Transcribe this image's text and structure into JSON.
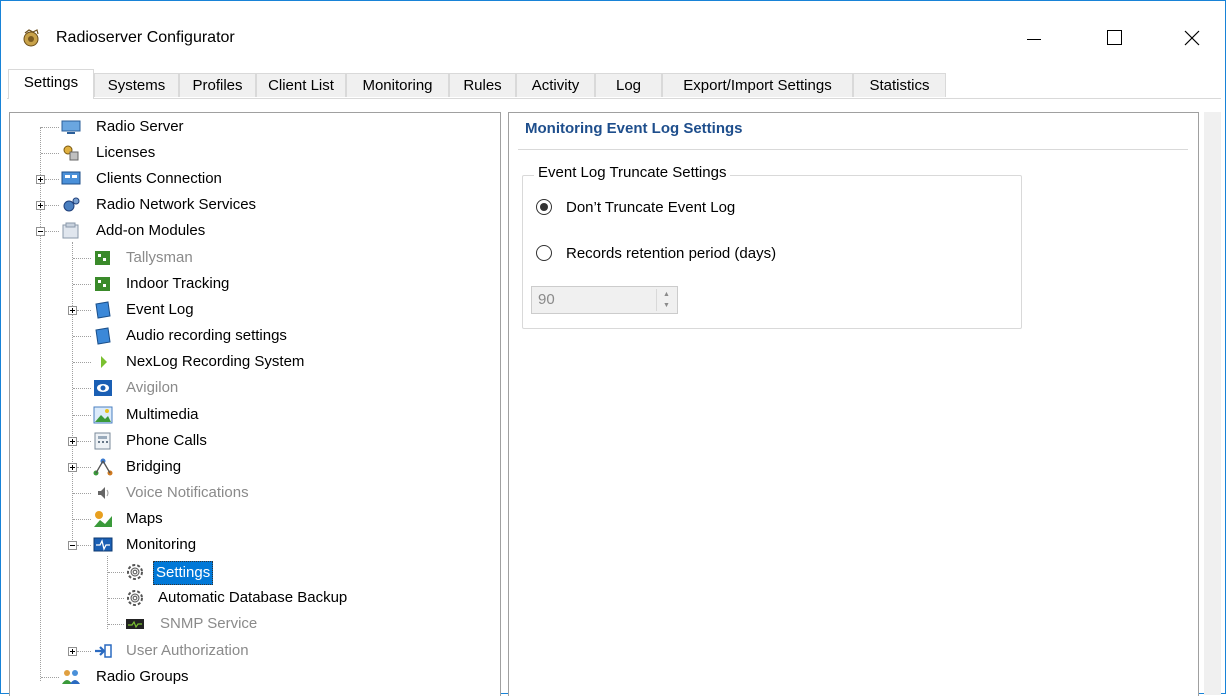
{
  "window": {
    "title": "Radioserver Configurator",
    "close_glyph": "×"
  },
  "tabs": [
    {
      "label": "Settings",
      "active": true
    },
    {
      "label": "Systems"
    },
    {
      "label": "Profiles"
    },
    {
      "label": "Client List"
    },
    {
      "label": "Monitoring"
    },
    {
      "label": "Rules"
    },
    {
      "label": "Activity"
    },
    {
      "label": "Log"
    },
    {
      "label": "Export/Import Settings"
    },
    {
      "label": "Statistics"
    }
  ],
  "tree": [
    {
      "label": "Radio Server",
      "icon": "server-icon"
    },
    {
      "label": "Licenses",
      "icon": "licenses-icon"
    },
    {
      "label": "Clients Connection",
      "icon": "clients-connection-icon",
      "expander": "plus"
    },
    {
      "label": "Radio Network Services",
      "icon": "radio-network-services-icon",
      "expander": "plus"
    },
    {
      "label": "Add-on Modules",
      "icon": "addon-modules-icon",
      "expander": "minus"
    },
    {
      "label": "Tallysman",
      "icon": "tallysman-icon",
      "disabled": true
    },
    {
      "label": "Indoor Tracking",
      "icon": "indoor-tracking-icon"
    },
    {
      "label": "Event Log",
      "icon": "event-log-icon",
      "expander": "plus"
    },
    {
      "label": "Audio recording settings",
      "icon": "audio-recording-icon"
    },
    {
      "label": "NexLog Recording System",
      "icon": "nexlog-icon"
    },
    {
      "label": "Avigilon",
      "icon": "avigilon-icon",
      "disabled": true
    },
    {
      "label": "Multimedia",
      "icon": "multimedia-icon"
    },
    {
      "label": "Phone Calls",
      "icon": "phone-calls-icon",
      "expander": "plus"
    },
    {
      "label": "Bridging",
      "icon": "bridging-icon",
      "expander": "plus"
    },
    {
      "label": "Voice Notifications",
      "icon": "speaker-icon",
      "disabled": true
    },
    {
      "label": "Maps",
      "icon": "maps-icon"
    },
    {
      "label": "Monitoring",
      "icon": "monitoring-icon",
      "expander": "minus"
    },
    {
      "label": "Settings",
      "icon": "gear-icon",
      "selected": true
    },
    {
      "label": "Automatic Database Backup",
      "icon": "gear-icon"
    },
    {
      "label": "SNMP Service",
      "icon": "snmp-icon",
      "disabled": true
    },
    {
      "label": "User Authorization",
      "icon": "user-authorization-icon",
      "expander": "plus",
      "disabled": true
    },
    {
      "label": "Radio Groups",
      "icon": "radio-groups-icon"
    }
  ],
  "panel": {
    "title": "Monitoring Event Log Settings",
    "group_title": "Event Log Truncate Settings",
    "options": [
      {
        "label": "Don’t Truncate Event Log",
        "checked": true
      },
      {
        "label": "Records retention period (days)",
        "checked": false
      }
    ],
    "retention_days": "90"
  },
  "colors": {
    "accent": "#0078d7",
    "section_title": "#1e4e8c",
    "disabled_text": "#8a8a8a"
  }
}
